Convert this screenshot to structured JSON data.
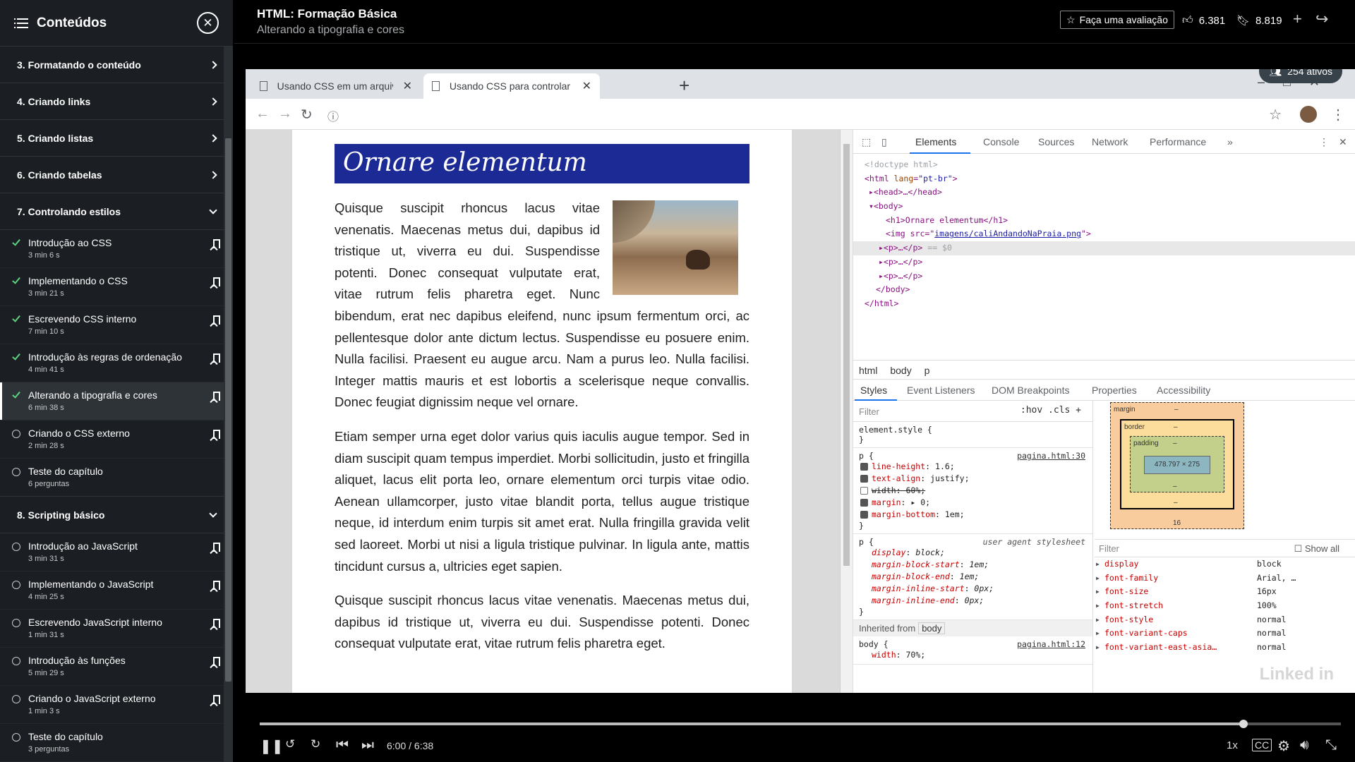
{
  "sidebar": {
    "title": "Conteúdos",
    "chapters_top": [
      {
        "label": "3. Formatando o conteúdo"
      },
      {
        "label": "4. Criando links"
      },
      {
        "label": "5. Criando listas"
      },
      {
        "label": "6. Criando tabelas"
      },
      {
        "label": "7. Controlando estilos"
      }
    ],
    "lessons_ch7": [
      {
        "title": "Introdução ao CSS",
        "duration": "3 min 6 s",
        "status": "done"
      },
      {
        "title": "Implementando o CSS",
        "duration": "3 min 21 s",
        "status": "done"
      },
      {
        "title": "Escrevendo CSS interno",
        "duration": "7 min 10 s",
        "status": "done"
      },
      {
        "title": "Introdução às regras de ordenação",
        "duration": "4 min 41 s",
        "status": "done"
      },
      {
        "title": "Alterando a tipografia e cores",
        "duration": "6 min 38 s",
        "status": "active"
      },
      {
        "title": "Criando o CSS externo",
        "duration": "2 min 28 s",
        "status": "todo"
      },
      {
        "title": "Teste do capítulo",
        "duration": "6 perguntas",
        "status": "todo"
      }
    ],
    "chapter8": {
      "label": "8. Scripting básico"
    },
    "lessons_ch8": [
      {
        "title": "Introdução ao JavaScript",
        "duration": "3 min 31 s"
      },
      {
        "title": "Implementando o JavaScript",
        "duration": "4 min 25 s"
      },
      {
        "title": "Escrevendo JavaScript interno",
        "duration": "1 min 31 s"
      },
      {
        "title": "Introdução às funções",
        "duration": "5 min 29 s"
      },
      {
        "title": "Criando o JavaScript externo",
        "duration": "1 min 3 s"
      },
      {
        "title": "Teste do capítulo",
        "duration": "3 perguntas"
      }
    ]
  },
  "header": {
    "course_title": "HTML: Formação Básica",
    "lesson_title": "Alterando a tipografia e cores",
    "rate_label": "Faça uma avaliação",
    "likes": "6.381",
    "saves": "8.819"
  },
  "browser": {
    "tab1": "Usando CSS em um arquivo exte",
    "tab2": "Usando CSS para controlar fonte",
    "active_users": "254 ativos"
  },
  "page": {
    "h1": "Ornare elementum",
    "p1": "Quisque suscipit rhoncus lacus vitae venenatis. Maecenas metus dui, dapibus id tristique ut, viverra eu dui. Suspendisse potenti. Donec consequat vulputate erat, vitae rutrum felis pharetra eget. Nunc bibendum, erat nec dapibus eleifend, nunc ipsum fermentum orci, ac pellentesque dolor ante dictum lectus. Suspendisse eu posuere enim. Nulla facilisi. Praesent eu augue arcu. Nam a purus leo. Nulla facilisi. Integer mattis mauris et est lobortis a scelerisque neque convallis. Donec feugiat dignissim neque vel ornare.",
    "p2": "Etiam semper urna eget dolor varius quis iaculis augue tempor. Sed in diam suscipit quam tempus imperdiet. Morbi sollicitudin, justo et fringilla aliquet, lacus elit porta leo, ornare elementum orci turpis vitae odio. Aenean ullamcorper, justo vitae blandit porta, tellus augue tristique neque, id interdum enim turpis sit amet erat. Nulla fringilla gravida velit sed laoreet. Morbi ut nisi a ligula tristique pulvinar. In ligula ante, mattis tincidunt cursus a, ultricies eget sapien.",
    "p3": "Quisque suscipit rhoncus lacus vitae venenatis. Maecenas metus dui, dapibus id tristique ut, viverra eu dui. Suspendisse potenti. Donec consequat vulputate erat, vitae rutrum felis pharetra eget."
  },
  "devtools": {
    "tabs": [
      "Elements",
      "Console",
      "Sources",
      "Network",
      "Performance",
      "»"
    ],
    "dom": {
      "doctype": "<!doctype html>",
      "html_open": "<html",
      "lang_attr": "lang",
      "lang_val": "\"pt-br\"",
      "head": "<head>…</head>",
      "body_open": "<body>",
      "h1": "<h1>Ornare elementum</h1>",
      "img_open": "<img src=",
      "img_src": "imagens/caliAndandoNaPraia.png",
      "p_sel": "<p>…</p>",
      "p_sel_note": "== $0",
      "p": "<p>…</p>",
      "body_close": "</body>",
      "html_close": "</html>"
    },
    "breadcrumbs": [
      "html",
      "body",
      "p"
    ],
    "style_tabs": [
      "Styles",
      "Event Listeners",
      "DOM Breakpoints",
      "Properties",
      "Accessibility"
    ],
    "filter_placeholder": "Filter",
    "hov_cls": ":hov .cls +",
    "element_style": "element.style {",
    "close_brace": "}",
    "p_rule": {
      "selector": "p {",
      "source": "pagina.html:30",
      "props": [
        {
          "name": "line-height",
          "value": "1.6;",
          "checked": true
        },
        {
          "name": "text-align",
          "value": "justify;",
          "checked": true
        },
        {
          "name": "width",
          "value": "60%;",
          "checked": false
        },
        {
          "name": "margin",
          "value": "▸ 0;",
          "checked": true
        },
        {
          "name": "margin-bottom",
          "value": "1em;",
          "checked": true
        }
      ]
    },
    "ua_rule": {
      "selector": "p {",
      "source": "user agent stylesheet",
      "props": [
        {
          "name": "display",
          "value": "block;"
        },
        {
          "name": "margin-block-start",
          "value": "1em;"
        },
        {
          "name": "margin-block-end",
          "value": "1em;"
        },
        {
          "name": "margin-inline-start",
          "value": "0px;"
        },
        {
          "name": "margin-inline-end",
          "value": "0px;"
        }
      ]
    },
    "inherited_from": "Inherited from",
    "inherited_tag": "body",
    "body_rule": {
      "selector": "body {",
      "source": "pagina.html:12",
      "prop": "width",
      "value": "70%;"
    },
    "box_model": {
      "margin": "margin",
      "border": "border",
      "padding": "padding",
      "content": "478.797 × 275",
      "dash": "–",
      "margin_bottom": "16"
    },
    "computed_filter": "Filter",
    "show_all": "Show all",
    "computed": [
      {
        "name": "display",
        "value": "block"
      },
      {
        "name": "font-family",
        "value": "Arial, …"
      },
      {
        "name": "font-size",
        "value": "16px"
      },
      {
        "name": "font-stretch",
        "value": "100%"
      },
      {
        "name": "font-style",
        "value": "normal"
      },
      {
        "name": "font-variant-caps",
        "value": "normal"
      },
      {
        "name": "font-variant-east-asia…",
        "value": "normal"
      }
    ]
  },
  "player": {
    "time": "6:00 / 6:38",
    "speed": "1x",
    "progress": 0.91
  }
}
